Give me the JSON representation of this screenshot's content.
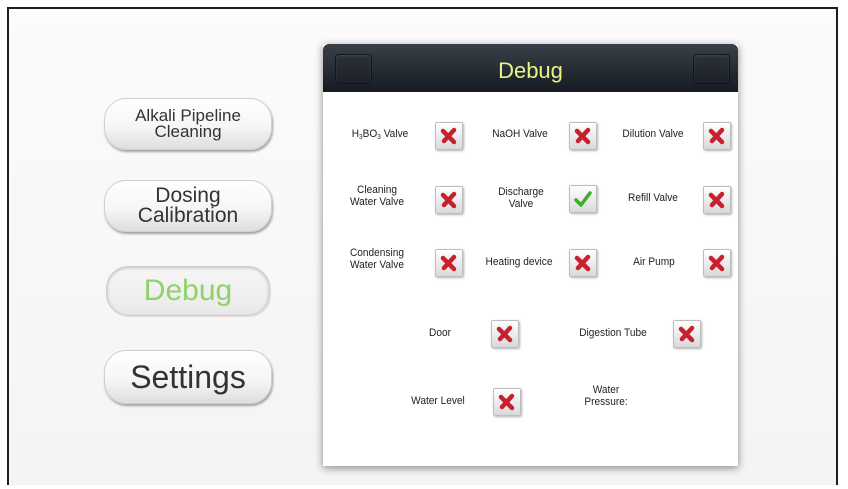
{
  "sidebar": {
    "items": [
      {
        "line1": "Alkali Pipeline",
        "line2": "Cleaning",
        "active": false
      },
      {
        "line1": "Dosing",
        "line2": "Calibration",
        "active": false
      },
      {
        "line1": "Debug",
        "line2": "",
        "active": true
      },
      {
        "line1": "Settings",
        "line2": "",
        "active": false
      }
    ]
  },
  "panel": {
    "title": "Debug",
    "devices": {
      "h3bo3_valve": {
        "pre": "H",
        "sub1": "3",
        "mid": "BO",
        "sub2": "3",
        "post": " Valve",
        "state": "off",
        "icon": "red-x-icon"
      },
      "naoh_valve": {
        "label": "NaOH Valve",
        "state": "off",
        "icon": "red-x-icon"
      },
      "dilution_valve": {
        "label": "Dilution Valve",
        "state": "off",
        "icon": "red-x-icon"
      },
      "cleaning_water_valve": {
        "line1": "Cleaning",
        "line2": "Water Valve",
        "state": "off",
        "icon": "red-x-icon"
      },
      "discharge_valve": {
        "line1": "Discharge",
        "line2": "Valve",
        "state": "on",
        "icon": "green-check-icon"
      },
      "refill_valve": {
        "label": "Refill Valve",
        "state": "off",
        "icon": "red-x-icon"
      },
      "condensing_water_valve": {
        "line1": "Condensing",
        "line2": "Water Valve",
        "state": "off",
        "icon": "red-x-icon"
      },
      "heating_device": {
        "label": "Heating device",
        "state": "off",
        "icon": "red-x-icon"
      },
      "air_pump": {
        "label": "Air Pump",
        "state": "off",
        "icon": "red-x-icon"
      },
      "door": {
        "label": "Door",
        "state": "off",
        "icon": "red-x-icon"
      },
      "digestion_tube": {
        "label": "Digestion Tube",
        "state": "off",
        "icon": "red-x-icon"
      },
      "water_level": {
        "label": "Water Level",
        "state": "off",
        "icon": "red-x-icon"
      },
      "water_pressure": {
        "line1": "Water",
        "line2": "Pressure:",
        "value": ""
      }
    }
  },
  "colors": {
    "title": "#e9f38a",
    "active_item": "#8fd16a",
    "x_mark": "#c8202c",
    "check_mark": "#3faa2c",
    "header": "#1c222a"
  }
}
